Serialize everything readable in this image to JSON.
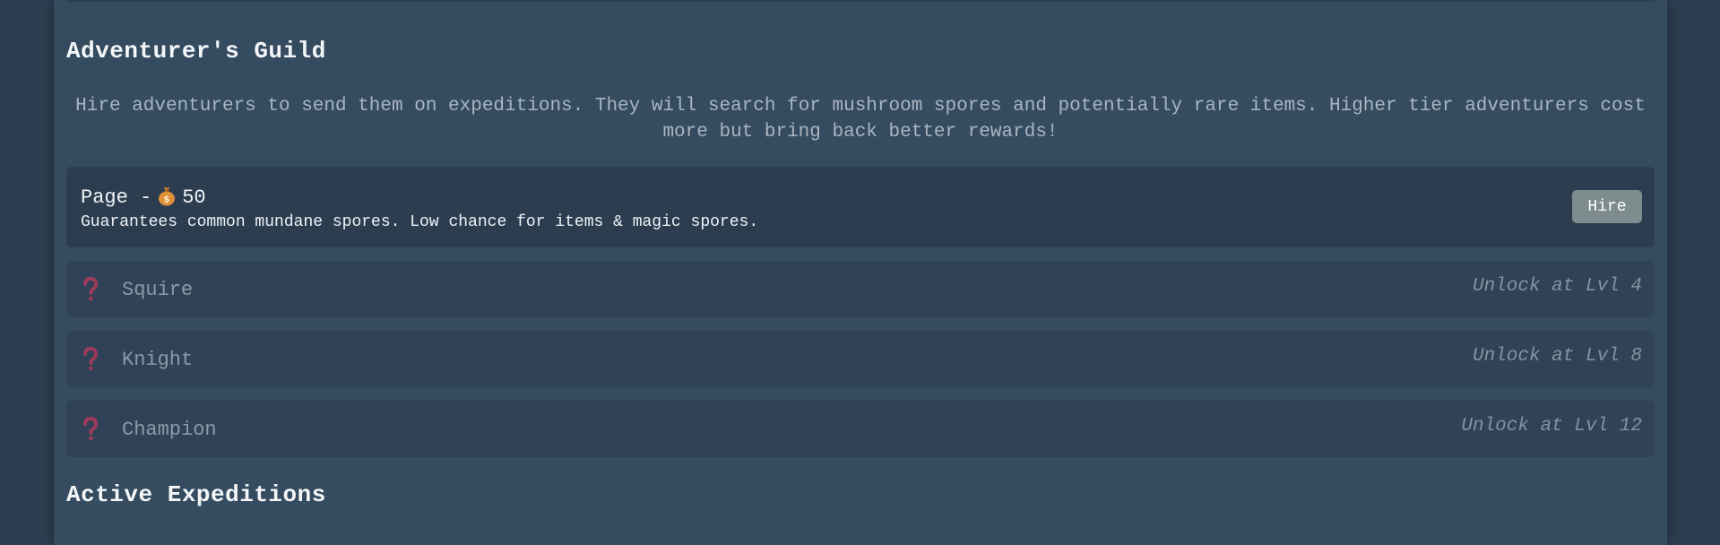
{
  "guild": {
    "title": "Adventurer's Guild",
    "description": "Hire adventurers to send them on expeditions. They will search for mushroom spores and potentially rare items. Higher tier adventurers cost more but bring back better rewards!"
  },
  "adventurers": {
    "page": {
      "name": "Page -",
      "cost": "50",
      "cost_icon": "money-bag-icon",
      "description": "Guarantees common mundane spores. Low chance for items & magic spores.",
      "hire_label": "Hire"
    },
    "locked": [
      {
        "name": "Squire",
        "unlock": "Unlock at Lvl 4",
        "icon": "question-mark-icon"
      },
      {
        "name": "Knight",
        "unlock": "Unlock at Lvl 8",
        "icon": "question-mark-icon"
      },
      {
        "name": "Champion",
        "unlock": "Unlock at Lvl 12",
        "icon": "question-mark-icon"
      }
    ]
  },
  "expeditions": {
    "title": "Active Expeditions"
  },
  "colors": {
    "page_background": "#2c3e50",
    "panel_background": "#344b60",
    "card_background": "#2c3d50",
    "locked_card_background": "#2f4257",
    "hire_button": "#7e8c8d",
    "question_mark": "#9b3a5a"
  }
}
